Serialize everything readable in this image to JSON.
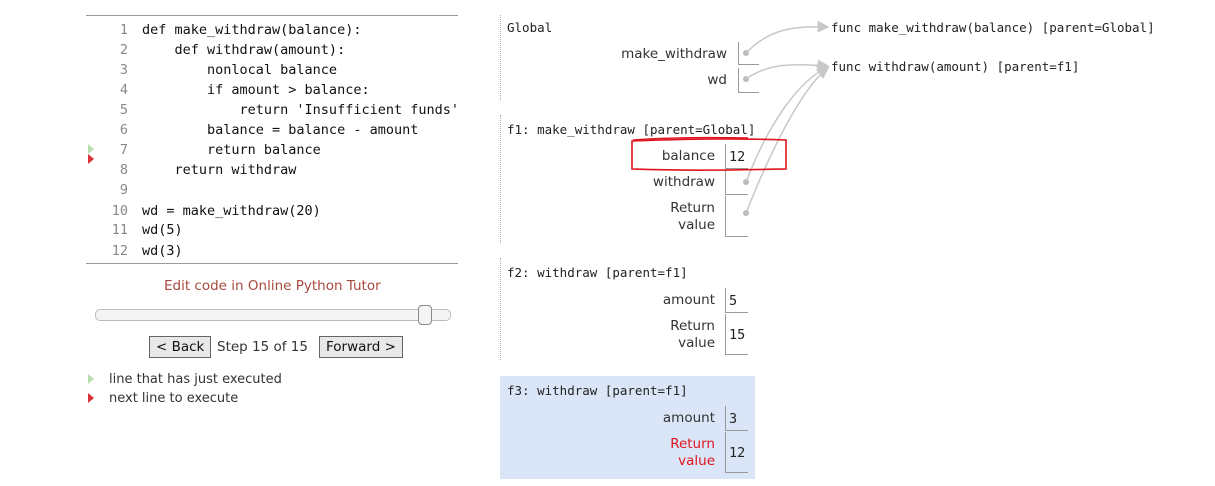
{
  "code": {
    "lines": [
      {
        "num": "1",
        "text": "def make_withdraw(balance):"
      },
      {
        "num": "2",
        "text": "    def withdraw(amount):"
      },
      {
        "num": "3",
        "text": "        nonlocal balance"
      },
      {
        "num": "4",
        "text": "        if amount > balance:"
      },
      {
        "num": "5",
        "text": "            return 'Insufficient funds'"
      },
      {
        "num": "6",
        "text": "        balance = balance - amount"
      },
      {
        "num": "7",
        "text": "        return balance"
      },
      {
        "num": "8",
        "text": "    return withdraw"
      },
      {
        "num": "9",
        "text": ""
      },
      {
        "num": "10",
        "text": "wd = make_withdraw(20)"
      },
      {
        "num": "11",
        "text": "wd(5)"
      },
      {
        "num": "12",
        "text": "wd(3)"
      }
    ]
  },
  "controls": {
    "edit_link": "Edit code in Online Python Tutor",
    "back_label": "< Back",
    "step_text": "Step 15 of 15",
    "forward_label": "Forward >",
    "slider_fraction": 1.0
  },
  "legend": {
    "just_executed": "line that has just executed",
    "next_line": "next line to execute"
  },
  "frames": {
    "global": {
      "title": "Global",
      "vars": [
        {
          "name": "make_withdraw",
          "value": ""
        },
        {
          "name": "wd",
          "value": ""
        }
      ]
    },
    "f1": {
      "title": "f1: make_withdraw [parent=Global]",
      "vars": [
        {
          "name": "balance",
          "value": "12"
        },
        {
          "name": "withdraw",
          "value": ""
        },
        {
          "name": "Return value",
          "value": ""
        }
      ]
    },
    "f2": {
      "title": "f2: withdraw [parent=f1]",
      "vars": [
        {
          "name": "amount",
          "value": "5"
        },
        {
          "name": "Return value",
          "value": "15"
        }
      ]
    },
    "f3": {
      "title": "f3: withdraw [parent=f1]",
      "vars": [
        {
          "name": "amount",
          "value": "3"
        },
        {
          "name": "Return value",
          "value": "12"
        }
      ]
    }
  },
  "objects": {
    "func1": "func make_withdraw(balance) [parent=Global]",
    "func2": "func withdraw(amount) [parent=f1]"
  },
  "colors": {
    "highlight_frame": "#dae6f7",
    "annotation_red": "#e0141e",
    "return_value_red": "#e0141e",
    "edit_link": "#a7493e"
  }
}
